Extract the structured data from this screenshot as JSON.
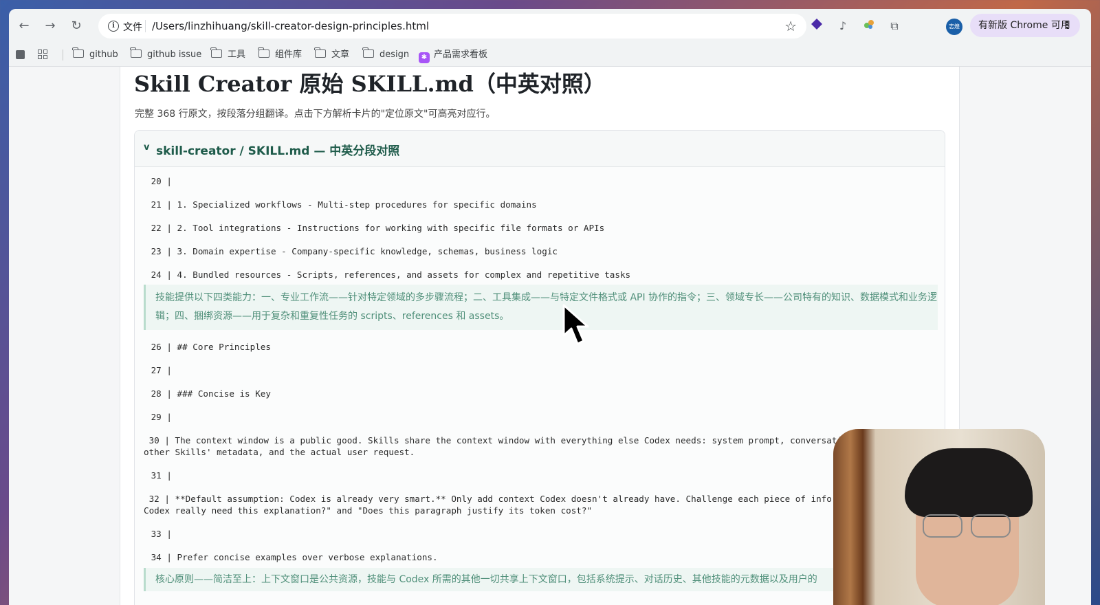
{
  "browser": {
    "scheme_label": "文件",
    "url": "/Users/linzhihuang/skill-creator-design-principles.html",
    "avatar_text": "志煌",
    "update_label": "有新版 Chrome 可用",
    "menu_dots": "⋮"
  },
  "bookmarks": [
    {
      "label": "github",
      "icon": "folder-icon"
    },
    {
      "label": "github issue",
      "icon": "folder-icon"
    },
    {
      "label": "工具",
      "icon": "folder-icon"
    },
    {
      "label": "组件库",
      "icon": "folder-icon"
    },
    {
      "label": "文章",
      "icon": "folder-icon"
    },
    {
      "label": "design",
      "icon": "folder-icon"
    },
    {
      "label": "产品需求看板",
      "icon": "app-icon"
    }
  ],
  "page": {
    "title": "Skill Creator 原始 SKILL.md（中英对照）",
    "subtitle": "完整 368 行原文，按段落分组翻译。点击下方解析卡片的\"定位原文\"可高亮对应行。",
    "panel": {
      "chevron": "v",
      "title": "skill-creator / SKILL.md — 中英分段对照"
    },
    "lines": [
      " 20 |",
      " 21 | 1. Specialized workflows - Multi-step procedures for specific domains",
      " 22 | 2. Tool integrations - Instructions for working with specific file formats or APIs",
      " 23 | 3. Domain expertise - Company-specific knowledge, schemas, business logic",
      " 24 | 4. Bundled resources - Scripts, references, and assets for complex and repetitive tasks",
      " 26 | ## Core Principles",
      " 27 |",
      " 28 | ### Concise is Key",
      " 29 |",
      " 30 | The context window is a public good. Skills share the context window with everything else Codex needs: system prompt, conversatio\nother Skills' metadata, and the actual user request.",
      " 31 |",
      " 32 | **Default assumption: Codex is already very smart.** Only add context Codex doesn't already have. Challenge each piece of info\nCodex really need this explanation?\" and \"Does this paragraph justify its token cost?\"",
      " 33 |",
      " 34 | Prefer concise examples over verbose explanations."
    ],
    "translations": [
      "技能提供以下四类能力：一、专业工作流——针对特定领域的多步骤流程；二、工具集成——与特定文件格式或 API 协作的指令；三、领域专长——公司特有的知识、数据模式和业务逻辑；四、捆绑资源——用于复杂和重复性任务的 scripts、references 和 assets。",
      "核心原则——简洁至上：上下文窗口是公共资源，技能与 Codex 所需的其他一切共享上下文窗口，包括系统提示、对话历史、其他技能的元数据以及用户的"
    ]
  }
}
